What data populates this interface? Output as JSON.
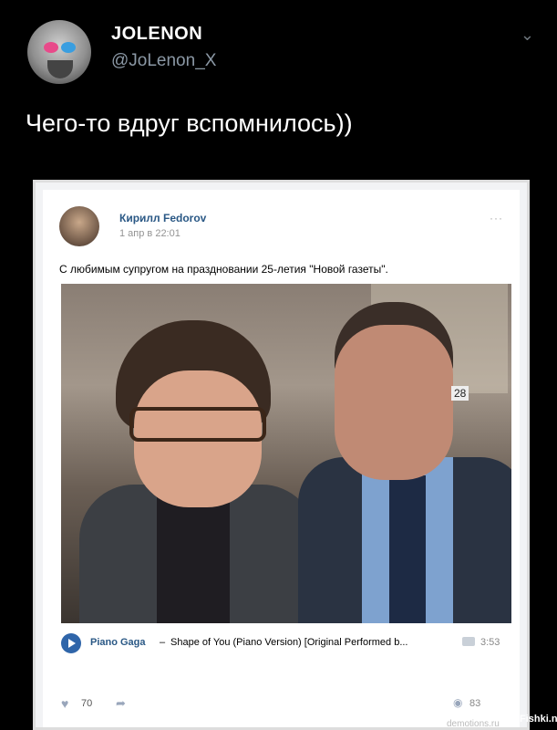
{
  "tweet": {
    "author_name": "JOLENON",
    "handle": "@JoLenon_X",
    "text": "Чего-то вдруг вспомнилось))",
    "menu_icon": "chevron-down-icon"
  },
  "vk_post": {
    "author": "Кирилл Fedorov",
    "time": "1 апр в 22:01",
    "text": "С любимым супругом на праздновании 25-летия \"Новой газеты\".",
    "more_label": "···",
    "photo_table_number": "28",
    "audio": {
      "artist": "Piano Gaga",
      "separator": "–",
      "title": "Shape of You (Piano Version) [Original Performed b...",
      "duration": "3:53"
    },
    "likes": "70",
    "views": "83"
  },
  "watermarks": {
    "demotions": "demotions.ru",
    "fishki": "Fishki.net"
  },
  "colors": {
    "background": "#000000",
    "vk_link": "#2a5885",
    "play_button": "#2f65a9"
  }
}
